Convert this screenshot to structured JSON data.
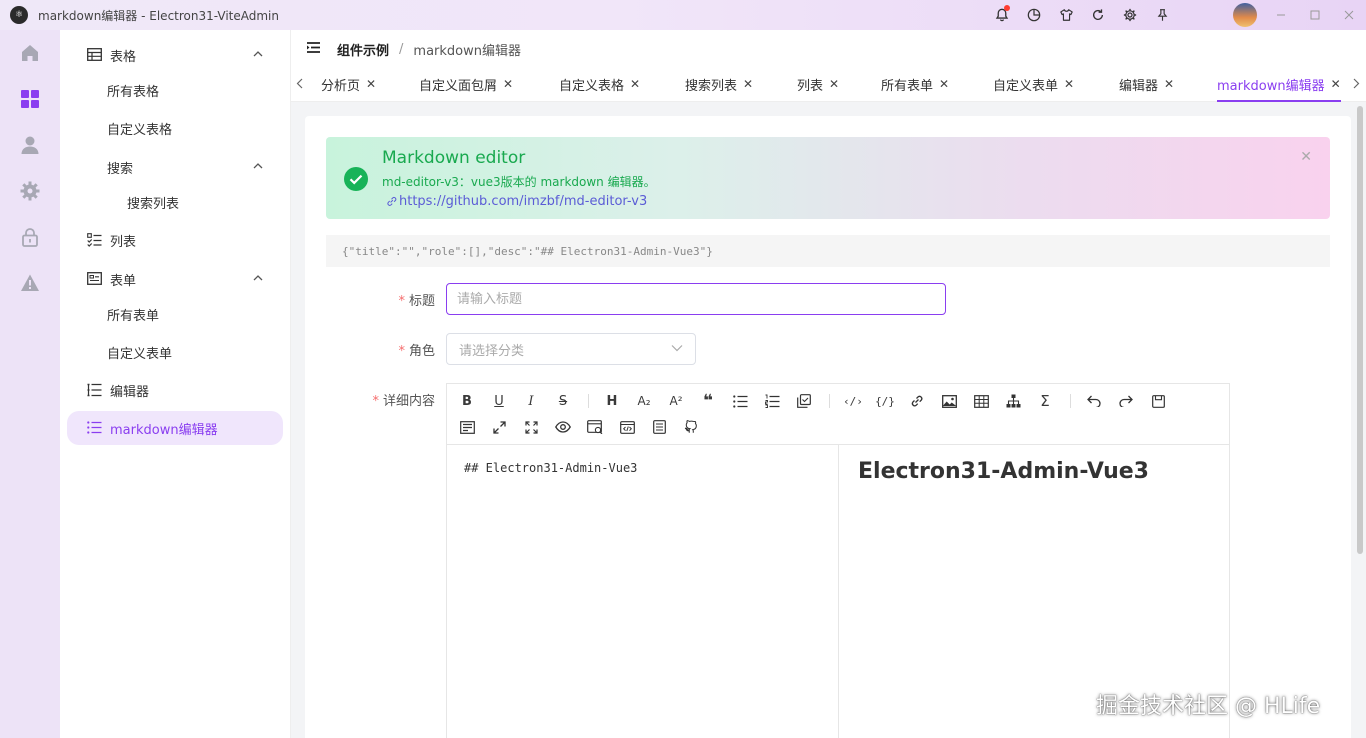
{
  "window": {
    "logo_text": "⚛",
    "title": "markdown编辑器 - Electron31-ViteAdmin"
  },
  "titlebar_icons": [
    "bell-icon",
    "pie-chart-icon",
    "shirt-icon",
    "refresh-icon",
    "gear-icon",
    "pin-icon"
  ],
  "accent_color": "#8a3ef0",
  "rail": {
    "items": [
      "home-icon",
      "dashboard-icon",
      "user-icon",
      "gear-icon",
      "lock-icon",
      "warning-icon"
    ],
    "active_index": 1
  },
  "sidebar": {
    "items": [
      {
        "label": "表格",
        "icon": "table-icon",
        "expanded": true
      },
      {
        "label": "所有表格"
      },
      {
        "label": "自定义表格"
      },
      {
        "label": "搜索",
        "expanded": true
      },
      {
        "label": "搜索列表"
      },
      {
        "label": "列表",
        "icon": "list-icon"
      },
      {
        "label": "表单",
        "icon": "form-icon",
        "expanded": true
      },
      {
        "label": "所有表单"
      },
      {
        "label": "自定义表单"
      },
      {
        "label": "编辑器",
        "icon": "editor-icon"
      },
      {
        "label": "markdown编辑器",
        "icon": "markdown-icon",
        "active": true
      }
    ]
  },
  "breadcrumb": {
    "parent": "组件示例",
    "separator": "/",
    "current": "markdown编辑器"
  },
  "tabs": [
    {
      "label": "分析页"
    },
    {
      "label": "自定义面包屑"
    },
    {
      "label": "自定义表格"
    },
    {
      "label": "搜索列表"
    },
    {
      "label": "列表"
    },
    {
      "label": "所有表单"
    },
    {
      "label": "自定义表单"
    },
    {
      "label": "编辑器"
    },
    {
      "label": "markdown编辑器",
      "active": true
    }
  ],
  "tab_close_glyph": "✕",
  "alert": {
    "title": "Markdown editor",
    "description": "md-editor-v3：vue3版本的 markdown 编辑器。",
    "link": "https://github.com/imzbf/md-editor-v3",
    "close_glyph": "✕"
  },
  "json_preview": "{\"title\":\"\",\"role\":[],\"desc\":\"## Electron31-Admin-Vue3\"}",
  "form": {
    "title_label": "标题",
    "title_placeholder": "请输入标题",
    "role_label": "角色",
    "role_placeholder": "请选择分类",
    "content_label": "详细内容"
  },
  "editor": {
    "toolbar": {
      "bold": "B",
      "underline": "U",
      "italic": "I",
      "strike": "S",
      "heading": "H",
      "sub": "A₂",
      "sup": "A²",
      "quote": "❝",
      "code_inline": "‹/›",
      "code_block": "{/}",
      "sum": "Σ"
    },
    "source": "## Electron31-Admin-Vue3",
    "preview_heading": "Electron31-Admin-Vue3"
  },
  "watermark": "掘金技术社区 @ HLife"
}
